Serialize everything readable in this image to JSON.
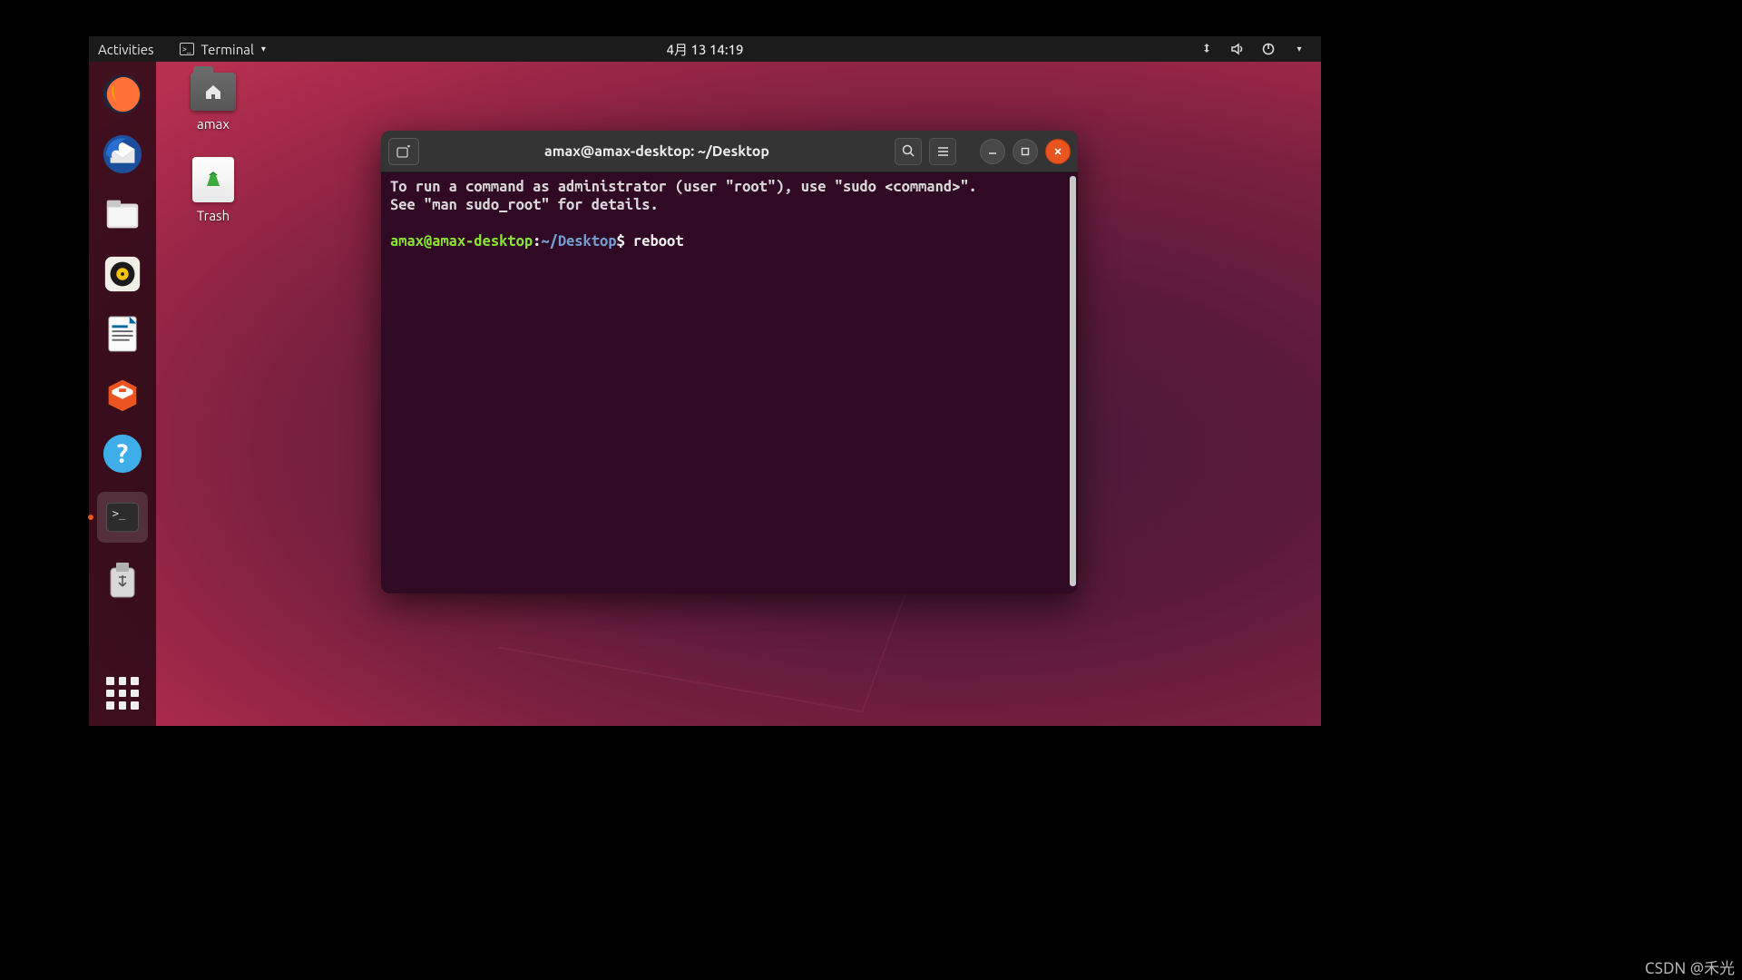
{
  "topbar": {
    "activities": "Activities",
    "app_label": "Terminal",
    "clock": "4月 13  14:19"
  },
  "desktop": {
    "home_folder": "amax",
    "trash": "Trash"
  },
  "dock": {
    "items": [
      {
        "name": "firefox"
      },
      {
        "name": "thunderbird"
      },
      {
        "name": "files"
      },
      {
        "name": "rhythmbox"
      },
      {
        "name": "libreoffice-writer"
      },
      {
        "name": "ubuntu-software"
      },
      {
        "name": "help"
      },
      {
        "name": "terminal",
        "active": true
      },
      {
        "name": "usb-drive"
      }
    ]
  },
  "terminal": {
    "title": "amax@amax-desktop: ~/Desktop",
    "message_line1": "To run a command as administrator (user \"root\"), use \"sudo <command>\".",
    "message_line2": "See \"man sudo_root\" for details.",
    "prompt_user": "amax@amax-desktop",
    "prompt_sep": ":",
    "prompt_path": "~/Desktop",
    "prompt_symbol": "$",
    "command": "reboot"
  },
  "watermark": "CSDN @禾光"
}
